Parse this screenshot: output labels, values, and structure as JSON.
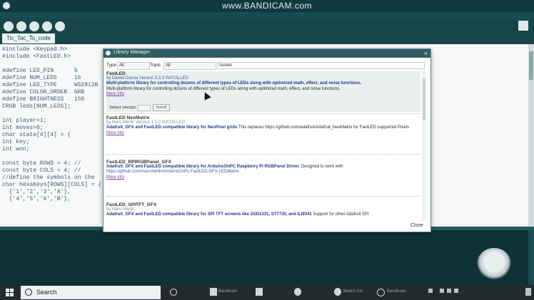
{
  "watermark": "www.BANDICAM.com",
  "sketch_tab": "Tic_Tac_To_code",
  "code_lines": [
    "#include <Keypad.h>",
    "#include <FastLED.h>",
    "",
    "#define LED_PIN      5",
    "#define NUM_LEDS     16",
    "#define LED_TYPE     WS2812B",
    "#define COLOR_ORDER  GRB",
    "#define BRIGHTNESS   150",
    "CRGB leds[NUM_LEDS];",
    "",
    "int player=1;",
    "int moves=0;",
    "char state[4][4] = {",
    "int key;",
    "int won;",
    "",
    "const byte ROWS = 4; //",
    "const byte COLS = 4; //",
    "//define the symbols on the",
    "char hexaKeys[ROWS][COLS] = {",
    "  {'1','2','3','A'},",
    "  {'4','5','6','B'},"
  ],
  "dialog": {
    "title": "Library Manager",
    "close_x": "×",
    "filter_type_label": "Type",
    "filter_type_value": "All",
    "filter_topic_label": "Topic",
    "filter_topic_value": "All",
    "search_value": "fastled",
    "close_label": "Close"
  },
  "libraries": [
    {
      "name": "FastLED",
      "by": "by Daniel Garcia Version 3.3.3 INSTALLED",
      "desc_bold": "Multi-platform library for controlling dozens of different types of LEDs along with optimized math, effect, and noise functions.",
      "desc": "Multi-platform library for controlling dozens of different types of LEDs along with optimized math, effect, and noise functions.",
      "link": "More info",
      "select_version_label": "Select version",
      "install_label": "Install"
    },
    {
      "name": "FastLED NeoMatrix",
      "by": "by Marc Merlin Version 1.1.0 INSTALLED",
      "desc_bold": "Adafruit_GFX and FastLED compatible library for NeoPixel grids",
      "desc": "This replaces https://github.com/adafruit/Adafruit_NeoMatrix for FastLED supported Pixels",
      "link": "More info"
    },
    {
      "name": "FastLED_RPIRGBPanel_GFX",
      "by": "",
      "desc_bold": "Adafruit_GFX and FastLED compatible library for ArduinoOnPC Raspberry Pi RGBPanel Driver.",
      "desc": "Designed to work with",
      "url": "https://github.com/marcmerlin/ArduinoOnPc-FastLED-GFX-LEDMatrix",
      "link": "More info"
    },
    {
      "name": "FastLED_SPITFT_GFX",
      "by": "by Marc Merlin",
      "desc_bold": "Adafruit_GFX and FastLED compatible library for SPI TFT screens like SSD1331, ST7735, and ILI9341",
      "desc": "Support for other Adafruit SPI",
      "link": ""
    }
  ],
  "taskbar": {
    "search_label": "Search",
    "apps": [
      "Bandicam",
      "",
      "Arduino",
      "Sketch.ino",
      "Bandicam"
    ],
    "clock_time": "",
    "clock_date": ""
  },
  "colors": {
    "ide_bg": "#17454a",
    "dialog_title": "#2f5f63",
    "desc_blue": "#1e3a8a"
  }
}
